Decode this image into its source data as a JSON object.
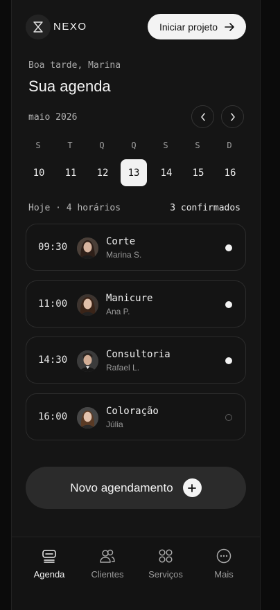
{
  "header": {
    "brand": "NEXO",
    "cta_label": "Iniciar projeto"
  },
  "greeting": "Boa tarde, Marina",
  "title": "Sua agenda",
  "calendar": {
    "month_label": "maio 2026",
    "weekdays": [
      "S",
      "T",
      "Q",
      "Q",
      "S",
      "S",
      "D"
    ],
    "days": [
      "10",
      "11",
      "12",
      "13",
      "14",
      "15",
      "16"
    ],
    "selected_day": "13"
  },
  "summary": {
    "left": "Hoje · 4 horários",
    "right": "3 confirmados"
  },
  "appointments": [
    {
      "time": "09:30",
      "service": "Corte",
      "client": "Marina S.",
      "status": "confirmed"
    },
    {
      "time": "11:00",
      "service": "Manicure",
      "client": "Ana P.",
      "status": "confirmed"
    },
    {
      "time": "14:30",
      "service": "Consultoria",
      "client": "Rafael L.",
      "status": "confirmed"
    },
    {
      "time": "16:00",
      "service": "Coloração",
      "client": "Júlia",
      "status": "pending"
    }
  ],
  "new_button_label": "Novo agendamento",
  "tabs": [
    {
      "label": "Agenda",
      "icon": "agenda-icon",
      "active": true
    },
    {
      "label": "Clientes",
      "icon": "clients-icon",
      "active": false
    },
    {
      "label": "Serviços",
      "icon": "services-icon",
      "active": false
    },
    {
      "label": "Mais",
      "icon": "more-icon",
      "active": false
    }
  ],
  "colors": {
    "background": "#0b0b0b",
    "surface": "#151515",
    "accent": "#f2f2f2"
  }
}
